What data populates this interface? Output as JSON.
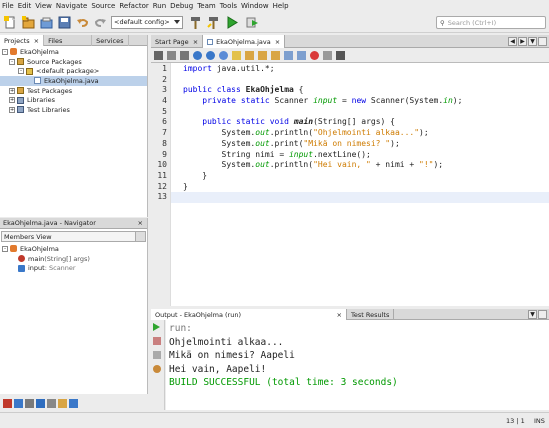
{
  "menu": [
    "File",
    "Edit",
    "View",
    "Navigate",
    "Source",
    "Refactor",
    "Run",
    "Debug",
    "Team",
    "Tools",
    "Window",
    "Help"
  ],
  "toolbar": {
    "config_value": "<default config>"
  },
  "search": {
    "placeholder": "Search (Ctrl+I)"
  },
  "left_tabs": [
    "Projects",
    "Files",
    "Services"
  ],
  "tree": [
    {
      "label": "EkaOhjelma",
      "level": 0
    },
    {
      "label": "Source Packages",
      "level": 1
    },
    {
      "label": "<default package>",
      "level": 2
    },
    {
      "label": "EkaOhjelma.java",
      "level": 3
    },
    {
      "label": "Test Packages",
      "level": 1
    },
    {
      "label": "Libraries",
      "level": 1
    },
    {
      "label": "Test Libraries",
      "level": 1
    }
  ],
  "navigator": {
    "title": "EkaOhjelma.java - Navigator",
    "view": "Members View",
    "root": "EkaOhjelma",
    "members": [
      {
        "name": "main",
        "suffix": "(String[] args)"
      },
      {
        "name": "input",
        "suffix": " : Scanner"
      }
    ]
  },
  "editor_tabs": [
    "Start Page",
    "EkaOhjelma.java"
  ],
  "code_lines": [
    "1",
    "2",
    "3",
    "4",
    "5",
    "6",
    "7",
    "8",
    "9",
    "10",
    "11",
    "12",
    "13"
  ],
  "code": {
    "l1_kw": "import",
    "l1_rest": " java.util.*;",
    "l3_kw1": "public",
    "l3_kw2": "class",
    "l3_name": "EkaOhjelma",
    "l3_rest": " {",
    "l4_kw1": "private",
    "l4_kw2": "static",
    "l4_type": " Scanner ",
    "l4_field": "input",
    "l4_eq": " = ",
    "l4_new": "new",
    "l4_rest1": " Scanner(System.",
    "l4_in": "in",
    "l4_rest2": ");",
    "l6_kw1": "public",
    "l6_kw2": "static",
    "l6_kw3": "void",
    "l6_name": "main",
    "l6_rest": "(String[] args) {",
    "l7_pre": "System.",
    "l7_out": "out",
    "l7_mid": ".println(",
    "l7_str": "\"Ohjelmointi alkaa...\"",
    "l7_end": ");",
    "l8_pre": "System.",
    "l8_out": "out",
    "l8_mid": ".print(",
    "l8_str": "\"Mikä on nimesi? \"",
    "l8_end": ");",
    "l9_pre": "String nimi = ",
    "l9_field": "input",
    "l9_end": ".nextLine();",
    "l10_pre": "System.",
    "l10_out": "out",
    "l10_mid": ".println(",
    "l10_str1": "\"Hei vain, \"",
    "l10_plus": " + nimi + ",
    "l10_str2": "\"!\"",
    "l10_end": ");",
    "l11": "}",
    "l12": "}"
  },
  "output_tabs": [
    "Output - EkaOhjelma (run)",
    "Test Results"
  ],
  "output_lines": [
    "run:",
    "Ohjelmointi alkaa...",
    "Mikä on nimesi? Aapeli",
    "Hei vain, Aapeli!",
    "BUILD SUCCESSFUL (total time: 3 seconds)"
  ],
  "status": {
    "position": "13 | 1",
    "mode": "INS"
  },
  "colors": {
    "keyword": "#0000e6",
    "string": "#ce7b00",
    "field": "#009900",
    "build_success": "#009900"
  }
}
